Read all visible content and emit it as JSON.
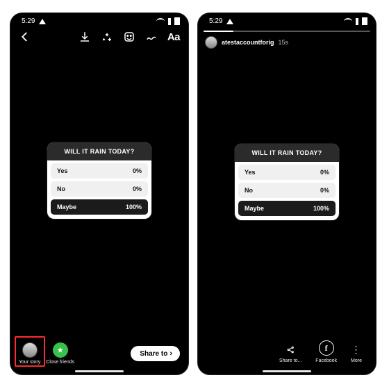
{
  "status": {
    "time": "5:29"
  },
  "editor": {
    "toolbar_aa": "Aa",
    "poll": {
      "title": "WILL IT RAIN TODAY?",
      "options": [
        {
          "label": "Yes",
          "pct": "0%"
        },
        {
          "label": "No",
          "pct": "0%"
        },
        {
          "label": "Maybe",
          "pct": "100%"
        }
      ]
    },
    "dest_your_story": "Your story",
    "dest_close_friends": "Close friends",
    "share_to": "Share to"
  },
  "viewer": {
    "username": "atestaccountforig",
    "age": "15s",
    "poll": {
      "title": "WILL IT RAIN TODAY?",
      "options": [
        {
          "label": "Yes",
          "pct": "0%"
        },
        {
          "label": "No",
          "pct": "0%"
        },
        {
          "label": "Maybe",
          "pct": "100%"
        }
      ]
    },
    "actions": {
      "share": "Share to...",
      "facebook": "Facebook",
      "more": "More"
    }
  }
}
